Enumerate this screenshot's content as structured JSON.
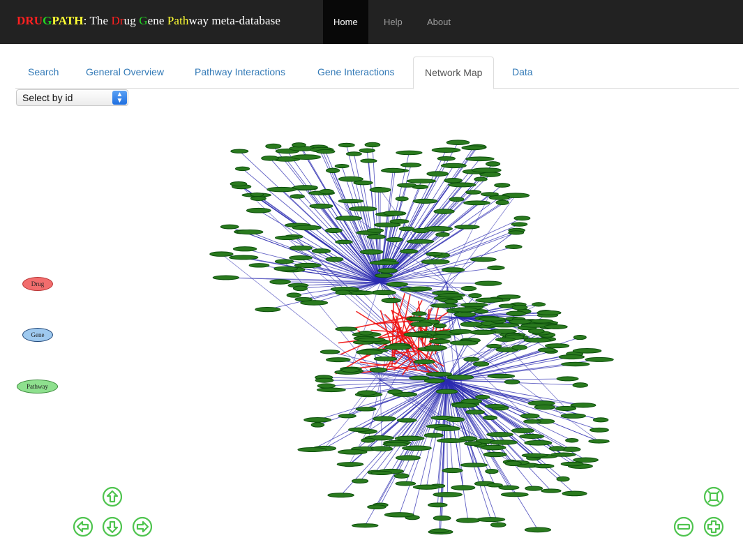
{
  "brand": {
    "part_drug_a": "DRU",
    "part_drug_b": "G",
    "part_path": "PATH",
    "colon": ": The ",
    "drug_d": "Dr",
    "drug_rest": "ug ",
    "gene_g": "G",
    "gene_rest": "ene ",
    "path_p": "Path",
    "tail": "way meta-database"
  },
  "nav": {
    "home": "Home",
    "help": "Help",
    "about": "About"
  },
  "tabs": [
    "Search",
    "General Overview",
    "Pathway Interactions",
    "Gene Interactions",
    "Network Map",
    "Data"
  ],
  "active_tab": "Network Map",
  "select": {
    "value": "Select by id",
    "arrow": "⌃⌄"
  },
  "legend": {
    "drug": "Drug",
    "gene": "Gene",
    "pathway": "Pathway"
  },
  "colors": {
    "drug": "#f26d6d",
    "gene": "#9ec9ef",
    "pathway": "#8ee08e",
    "node": "#2a7a1e",
    "node_stroke": "#0f5a0f",
    "edge": "#2b2bb0",
    "drug_edge": "#ee1111",
    "control": "#4fc44f"
  },
  "controls": {
    "pan_up": "arrow-up-icon",
    "pan_left": "arrow-left-icon",
    "pan_down": "arrow-down-icon",
    "pan_right": "arrow-right-icon",
    "fit": "fit-icon",
    "zoom_out": "minus-icon",
    "zoom_in": "plus-icon"
  }
}
